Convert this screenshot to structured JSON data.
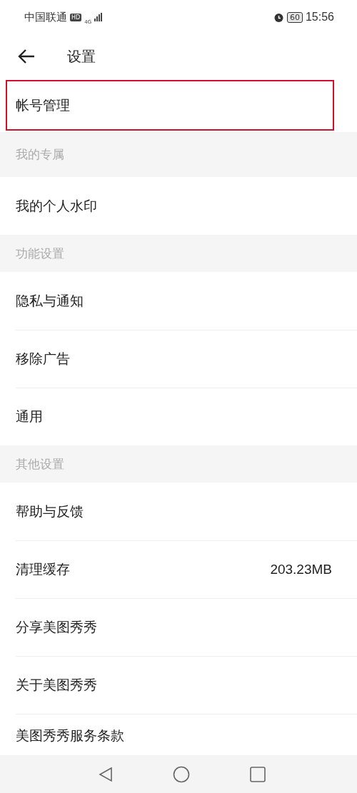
{
  "status_bar": {
    "carrier": "中国联通",
    "hd": "HD",
    "network": "4G",
    "battery": "60",
    "time": "15:56"
  },
  "header": {
    "title": "设置"
  },
  "sections": [
    {
      "items": [
        {
          "label": "帐号管理",
          "highlighted": true
        }
      ]
    },
    {
      "title": "我的专属",
      "items": [
        {
          "label": "我的个人水印",
          "highlighted": false
        }
      ]
    },
    {
      "title": "功能设置",
      "items": [
        {
          "label": "隐私与通知",
          "highlighted": false
        },
        {
          "label": "移除广告",
          "highlighted": false
        },
        {
          "label": "通用",
          "highlighted": false
        }
      ]
    },
    {
      "title": "其他设置",
      "items": [
        {
          "label": "帮助与反馈",
          "highlighted": false
        },
        {
          "label": "清理缓存",
          "value": "203.23MB",
          "highlighted": false
        },
        {
          "label": "分享美图秀秀",
          "highlighted": false
        },
        {
          "label": "关于美图秀秀",
          "highlighted": false
        },
        {
          "label": "美图秀秀服务条款",
          "highlighted": false
        }
      ]
    }
  ]
}
